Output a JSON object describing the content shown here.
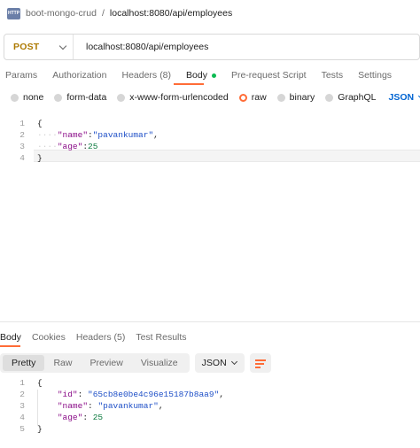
{
  "breadcrumb": {
    "icon": "http-icon",
    "icon_text": "HTTP",
    "parent": "boot-mongo-crud",
    "separator": "/",
    "current": "localhost:8080/api/employees"
  },
  "request": {
    "method": "POST",
    "url": "localhost:8080/api/employees"
  },
  "request_tabs": [
    {
      "label": "Params",
      "active": false
    },
    {
      "label": "Authorization",
      "active": false
    },
    {
      "label": "Headers",
      "count": "(8)",
      "active": false
    },
    {
      "label": "Body",
      "active": true,
      "indicator_color": "#0cbb52"
    },
    {
      "label": "Pre-request Script",
      "active": false
    },
    {
      "label": "Tests",
      "active": false
    },
    {
      "label": "Settings",
      "active": false
    }
  ],
  "body_types": [
    {
      "label": "none",
      "selected": false
    },
    {
      "label": "form-data",
      "selected": false
    },
    {
      "label": "x-www-form-urlencoded",
      "selected": false
    },
    {
      "label": "raw",
      "selected": true
    },
    {
      "label": "binary",
      "selected": false
    },
    {
      "label": "GraphQL",
      "selected": false
    }
  ],
  "raw_format": "JSON",
  "request_body_lines": [
    {
      "n": "1",
      "text": "{"
    },
    {
      "n": "2",
      "key": "\"name\"",
      "sep": ":",
      "value": "\"pavankumar\"",
      "tail": ","
    },
    {
      "n": "3",
      "key": "\"age\"",
      "sep": ":",
      "value": "25",
      "tail": ""
    },
    {
      "n": "4",
      "text": "}"
    }
  ],
  "response_tabs": [
    {
      "label": "Body",
      "active": true
    },
    {
      "label": "Cookies",
      "active": false
    },
    {
      "label": "Headers",
      "count": "(5)",
      "active": false
    },
    {
      "label": "Test Results",
      "active": false
    }
  ],
  "view_modes": [
    {
      "label": "Pretty",
      "active": true
    },
    {
      "label": "Raw",
      "active": false
    },
    {
      "label": "Preview",
      "active": false
    },
    {
      "label": "Visualize",
      "active": false
    }
  ],
  "response_format": "JSON",
  "response_body_lines": [
    {
      "n": "1",
      "text": "{"
    },
    {
      "n": "2",
      "key": "\"id\"",
      "sep": ": ",
      "value": "\"65cb8e0be4c96e15187b8aa9\"",
      "tail": ","
    },
    {
      "n": "3",
      "key": "\"name\"",
      "sep": ": ",
      "value": "\"pavankumar\"",
      "tail": ","
    },
    {
      "n": "4",
      "key": "\"age\"",
      "sep": ": ",
      "value": "25",
      "tail": ""
    },
    {
      "n": "5",
      "text": "}"
    }
  ],
  "colors": {
    "accent": "#ff6c37",
    "method_post": "#ad7a03",
    "json_link": "#0265d2",
    "json_key": "#8a0c88",
    "json_string": "#1e4fc7",
    "json_number": "#0b7a3e"
  }
}
